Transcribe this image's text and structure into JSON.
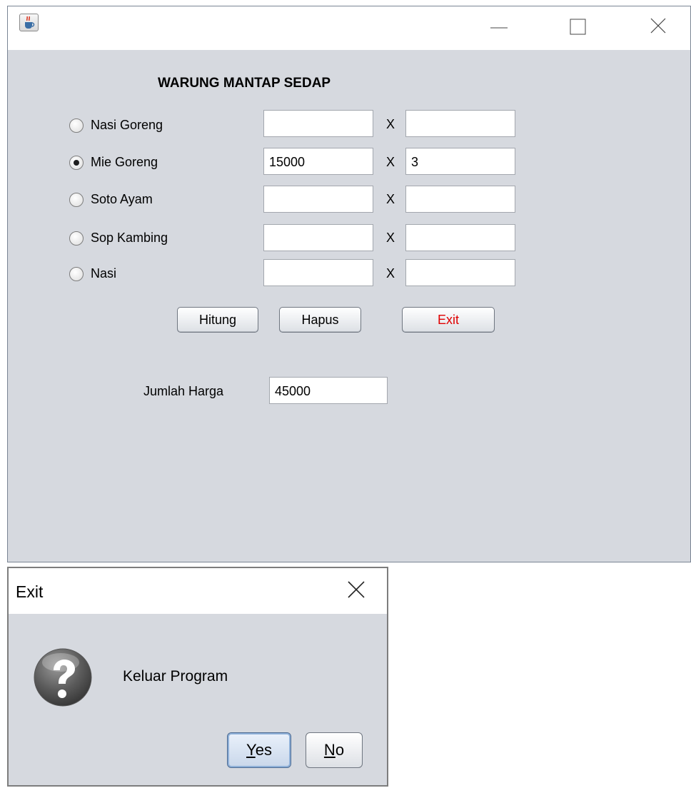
{
  "main_window": {
    "app_title": "WARUNG MANTAP SEDAP",
    "menu_items": [
      {
        "label": "Nasi Goreng",
        "selected": false,
        "price": "",
        "qty": ""
      },
      {
        "label": "Mie Goreng",
        "selected": true,
        "price": "15000",
        "qty": "3"
      },
      {
        "label": "Soto Ayam",
        "selected": false,
        "price": "",
        "qty": ""
      },
      {
        "label": "Sop Kambing",
        "selected": false,
        "price": "",
        "qty": ""
      },
      {
        "label": "Nasi",
        "selected": false,
        "price": "",
        "qty": ""
      }
    ],
    "multiply_symbol": "X",
    "buttons": {
      "hitung": "Hitung",
      "hapus": "Hapus",
      "exit": "Exit"
    },
    "total_label": "Jumlah Harga",
    "total_value": "45000",
    "icons": {
      "app": "java-cup-icon",
      "minimize": "minimize-icon",
      "maximize": "maximize-icon",
      "close": "close-icon"
    },
    "colors": {
      "background": "#d6d9df",
      "exit_text": "#e00000"
    }
  },
  "dialog": {
    "title": "Exit",
    "message": "Keluar Program",
    "icon": "question-icon",
    "yes_mnemonic": "Y",
    "yes_rest": "es",
    "no_mnemonic": "N",
    "no_rest": "o"
  }
}
